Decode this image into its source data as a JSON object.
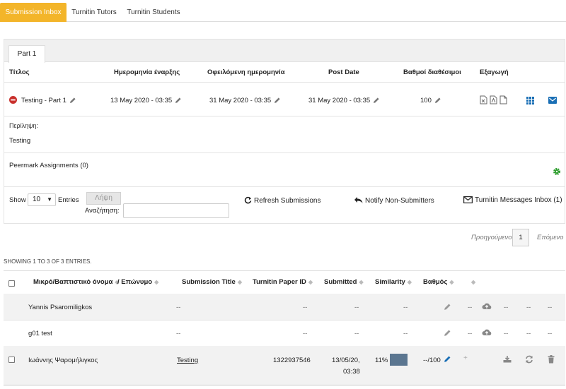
{
  "tabs": [
    "Submission Inbox",
    "Turnitin Tutors",
    "Turnitin Students"
  ],
  "part_tab": "Part 1",
  "assignment_table": {
    "headers": [
      "Τίτλος",
      "Ημερομηνία έναρξης",
      "Οφειλόμενη ημερομηνία",
      "Post Date",
      "Βαθμοί διαθέσιμοι",
      "Εξαγωγή"
    ],
    "row": {
      "title": "Testing - Part 1",
      "start_date": "13 May 2020 - 03:35",
      "due_date": "31 May 2020 - 03:35",
      "post_date": "31 May 2020 - 03:35",
      "max_marks": "100"
    },
    "summary_label": "Περίληψη:",
    "summary_text": "Testing",
    "peermark": "Peermark Assignments (0)"
  },
  "controls": {
    "show_label": "Show",
    "page_size": "10",
    "entries_label": "Entries",
    "download_button": "Λήψη",
    "search_label": "Αναζήτηση:",
    "search_value": "",
    "refresh": "Refresh Submissions",
    "notify": "Notify Non-Submitters",
    "messages": "Turnitin Messages Inbox (1)"
  },
  "pagination": {
    "previous": "Προηγούμενο",
    "current": "1",
    "next": "Επόμενο"
  },
  "showing": "SHOWING 1 TO 3 OF 3 ENTRIES.",
  "submissions": {
    "headers": [
      "Μικρό/Βαπτιστικό όνομα",
      "/ Επώνυμο",
      "Submission Title",
      "Turnitin Paper ID",
      "Submitted",
      "Similarity",
      "Βαθμός"
    ],
    "rows": [
      {
        "name": "Yannis Psaromiligkos",
        "title": "--",
        "paper_id": "--",
        "submitted": "--",
        "similarity": "--",
        "grade": "--",
        "c1": "--",
        "c2": "--",
        "c3": "--"
      },
      {
        "name": "g01 test",
        "title": "--",
        "paper_id": "--",
        "submitted": "--",
        "similarity": "--",
        "grade": "--",
        "c1": "--",
        "c2": "--",
        "c3": "--"
      },
      {
        "name": "Ιωάννης Ψαρομήλιγκος",
        "title": "Testing",
        "paper_id": "1322937546",
        "submitted_date": "13/05/20,",
        "submitted_time": "03:38",
        "similarity": "11%",
        "similarity_fraction": 0.11,
        "grade": "--/100"
      }
    ]
  },
  "colors": {
    "tab_active": "#f3b52a",
    "green_gear": "#2e9e2e",
    "blue_icon": "#1a6fb5",
    "similarity_bar": "#5b7690"
  }
}
